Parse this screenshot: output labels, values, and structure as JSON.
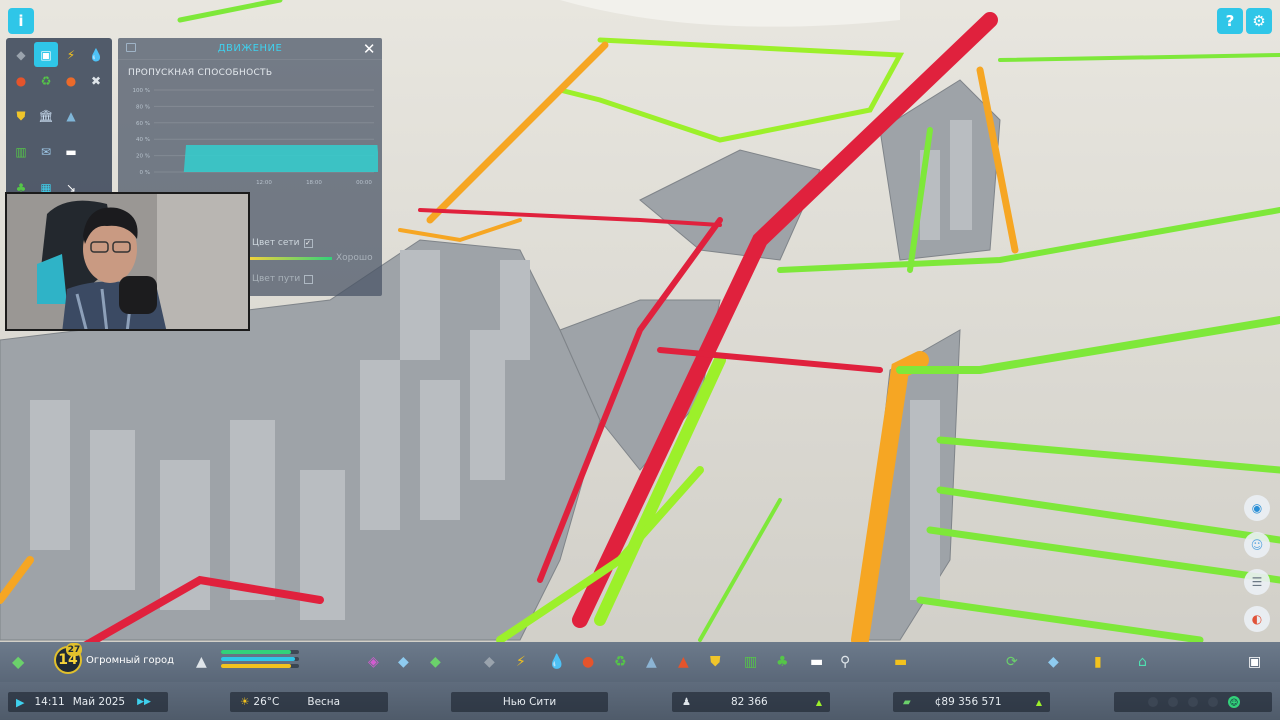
{
  "top_left": {
    "info_icon": "info-icon"
  },
  "top_right": {
    "help_icon": "help-icon",
    "settings_icon": "gear-icon"
  },
  "palette": {
    "items": [
      {
        "icon": "road-icon",
        "glyph": "◆",
        "color": "#9aa3ad"
      },
      {
        "icon": "traffic-icon",
        "glyph": "▣",
        "color": "#2fc6e8",
        "selected": true
      },
      {
        "icon": "electricity-icon",
        "glyph": "⚡",
        "color": "#f3c21d"
      },
      {
        "icon": "water-icon",
        "glyph": "💧",
        "color": "#35b5f0"
      },
      {
        "icon": "fire-icon",
        "glyph": "●",
        "color": "#e5542b"
      },
      {
        "icon": "recycle-icon",
        "glyph": "♻",
        "color": "#55c548"
      },
      {
        "icon": "health-icon",
        "glyph": "●",
        "color": "#ec6a2a"
      },
      {
        "icon": "tools-icon",
        "glyph": "✖",
        "color": "#dfe5ea"
      },
      {
        "icon": "police-icon",
        "glyph": "⛊",
        "color": "#f0c52a"
      },
      {
        "icon": "education-icon",
        "glyph": "🏛",
        "color": "#cde0f4"
      },
      {
        "icon": "graduation-icon",
        "glyph": "▲",
        "color": "#7fb6d8"
      },
      {
        "icon": "blank-icon",
        "glyph": "",
        "color": "#000"
      },
      {
        "icon": "transport-icon",
        "glyph": "▥",
        "color": "#55c548"
      },
      {
        "icon": "mail-icon",
        "glyph": "✉",
        "color": "#9ec8e8"
      },
      {
        "icon": "chat-icon",
        "glyph": "▬",
        "color": "#ffffff"
      },
      {
        "icon": "blank-icon",
        "glyph": "",
        "color": "#000"
      },
      {
        "icon": "tree-icon",
        "glyph": "♣",
        "color": "#55c548"
      },
      {
        "icon": "building-icon",
        "glyph": "▦",
        "color": "#3fd1ee"
      },
      {
        "icon": "arrow-icon",
        "glyph": "↘",
        "color": "#ffffff"
      },
      {
        "icon": "blank-icon",
        "glyph": "",
        "color": "#000"
      }
    ]
  },
  "traffic_panel": {
    "title": "ДВИЖЕНИЕ",
    "subtitle": "ПРОПУСКНАЯ СПОСОБНОСТЬ",
    "legend": [
      {
        "label": "Цвет сети",
        "checked": true
      },
      {
        "label": "Хорошо",
        "checked": false
      },
      {
        "label": "Цвет пути",
        "checked": false
      }
    ]
  },
  "chart_data": {
    "type": "area",
    "title": "ПРОПУСКНАЯ СПОСОБНОСТЬ",
    "y_ticks": [
      "100 %",
      "80 %",
      "60 %",
      "40 %",
      "20 %",
      "0 %"
    ],
    "x_ticks": [
      "",
      "",
      "12:00",
      "18:00",
      "00:00"
    ],
    "ylim": [
      0,
      100
    ],
    "series": [
      {
        "values": [
          0,
          0,
          33,
          33,
          33,
          33,
          0
        ]
      }
    ],
    "x": [
      0,
      0.09,
      0.1,
      0.4,
      0.7,
      0.97,
      0.98
    ],
    "fill_color": "#33cfcf"
  },
  "toolbar": {
    "city_level": "14",
    "city_level_sup": "27",
    "city_size": "Огромный город",
    "bars": [
      {
        "color": "#33d17a",
        "fill": 0.9
      },
      {
        "color": "#2fc6e8",
        "fill": 0.95
      },
      {
        "color": "#f3c21d",
        "fill": 0.9
      }
    ],
    "tools": [
      {
        "icon": "zoning-icon",
        "glyph": "◈",
        "color": "#d35cd0"
      },
      {
        "icon": "area-icon",
        "glyph": "◆",
        "color": "#8ecbf0"
      },
      {
        "icon": "landscape-icon",
        "glyph": "◆",
        "color": "#6bd16b"
      },
      {
        "icon": "road-tool-icon",
        "glyph": "◆",
        "color": "#9aa3ad"
      },
      {
        "icon": "electricity-tool-icon",
        "glyph": "⚡",
        "color": "#f3c21d"
      },
      {
        "icon": "water-tool-icon",
        "glyph": "💧",
        "color": "#35b5f0"
      },
      {
        "icon": "fire-tool-icon",
        "glyph": "●",
        "color": "#e5542b"
      },
      {
        "icon": "recycle-tool-icon",
        "glyph": "♻",
        "color": "#55c548"
      },
      {
        "icon": "education-tool-icon",
        "glyph": "▲",
        "color": "#8cb4d4"
      },
      {
        "icon": "police-tool-icon",
        "glyph": "▲",
        "color": "#e5542b"
      },
      {
        "icon": "shield-tool-icon",
        "glyph": "⛊",
        "color": "#f0c52a"
      },
      {
        "icon": "transport-tool-icon",
        "glyph": "▥",
        "color": "#55c548"
      },
      {
        "icon": "park-tool-icon",
        "glyph": "♣",
        "color": "#55c548"
      },
      {
        "icon": "chat-tool-icon",
        "glyph": "▬",
        "color": "#ffffff"
      },
      {
        "icon": "shovel-tool-icon",
        "glyph": "⚲",
        "color": "#dfe5ea"
      },
      {
        "icon": "industry-tool-icon",
        "glyph": "▬",
        "color": "#f3c21d"
      },
      {
        "icon": "replace-tool-icon",
        "glyph": "⟳",
        "color": "#6bd16b"
      },
      {
        "icon": "map-tool-icon",
        "glyph": "◆",
        "color": "#8ecbf0"
      },
      {
        "icon": "stats-tool-icon",
        "glyph": "▮",
        "color": "#f3c21d"
      },
      {
        "icon": "home-tool-icon",
        "glyph": "⌂",
        "color": "#4fe0b0"
      },
      {
        "icon": "camera-tool-icon",
        "glyph": "▣",
        "color": "#ffffff"
      }
    ]
  },
  "status": {
    "time": "14:11",
    "date": "Май 2025",
    "temperature": "26°C",
    "season": "Весна",
    "city_name": "Нью Сити",
    "population": "82 366",
    "money": "¢89 356 571"
  },
  "side_tools": [
    {
      "icon": "compass-icon",
      "glyph": "◉",
      "color": "#2a8fd6"
    },
    {
      "icon": "person-icon",
      "glyph": "☺",
      "color": "#5fa9e0"
    },
    {
      "icon": "notes-icon",
      "glyph": "☰",
      "color": "#6b7885"
    },
    {
      "icon": "radio-icon",
      "glyph": "◐",
      "color": "#e0533a"
    }
  ]
}
